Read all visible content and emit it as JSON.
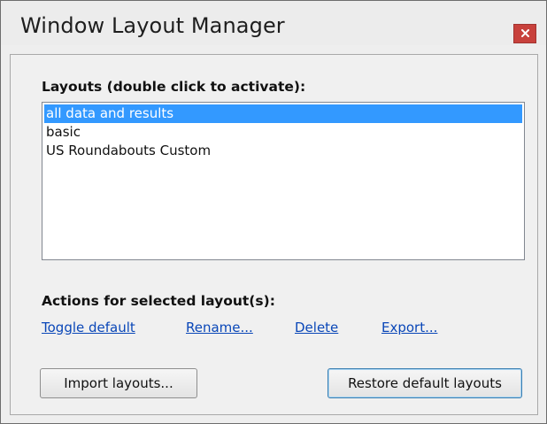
{
  "window": {
    "title": "Window Layout Manager",
    "close_glyph": "×"
  },
  "layouts": {
    "label": "Layouts (double click to activate):",
    "items": [
      "all data and results",
      "basic",
      "US Roundabouts Custom"
    ],
    "selected_index": 0
  },
  "actions": {
    "label": "Actions for selected layout(s):",
    "toggle_default": "Toggle default",
    "rename": "Rename...",
    "delete": "Delete",
    "export": "Export..."
  },
  "buttons": {
    "import": "Import layouts...",
    "restore": "Restore default layouts"
  },
  "colors": {
    "selection": "#3399ff",
    "link": "#0a47b8",
    "close_button": "#c8413c"
  },
  "icons": {
    "close": "close-icon"
  }
}
